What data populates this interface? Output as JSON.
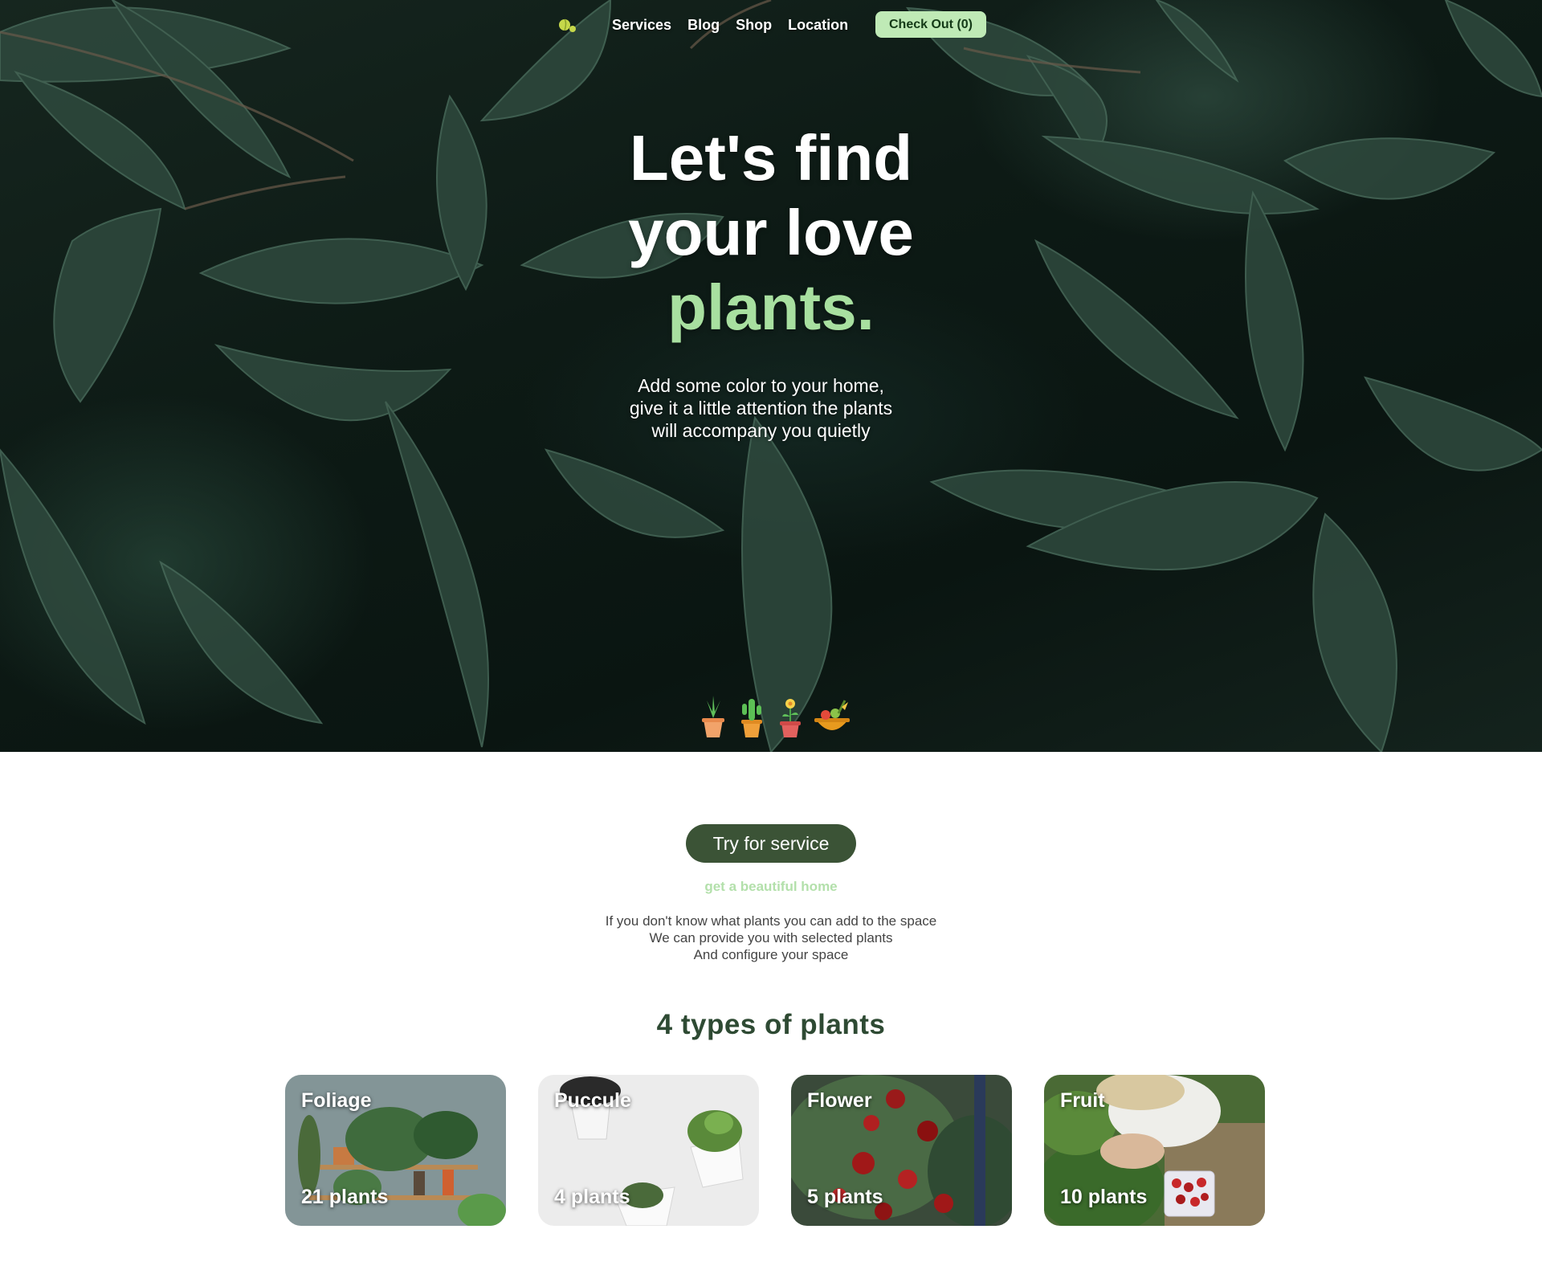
{
  "nav": {
    "links": [
      "Services",
      "Blog",
      "Shop",
      "Location"
    ],
    "checkout_label": "Check Out (0)"
  },
  "hero": {
    "title_line1": "Let's find",
    "title_line2": "your love",
    "title_accent": "plants.",
    "subtitle_lines": [
      "Add some color to your home,",
      "give it a little attention the plants",
      "will accompany you quietly"
    ],
    "pot_icons": [
      "succulent-pot-icon",
      "cactus-pot-icon",
      "flower-pot-icon",
      "fruit-bowl-icon"
    ]
  },
  "service": {
    "button_label": "Try for service",
    "tagline": "get a beautiful home",
    "description_lines": [
      "If you don't know what plants you can add to the space",
      "We can provide you with selected plants",
      "And configure your space"
    ]
  },
  "types": {
    "title": "4 types of plants",
    "cards": [
      {
        "name": "Foliage",
        "count": "21 plants"
      },
      {
        "name": "Puccule",
        "count": "4 plants"
      },
      {
        "name": "Flower",
        "count": "5 plants"
      },
      {
        "name": "Fruit",
        "count": "10 plants"
      }
    ]
  },
  "colors": {
    "accent_green": "#a8e0a0",
    "button_dark_green": "#3b5336",
    "checkout_bg": "#bfeab6",
    "heading_green": "#2e4a33"
  }
}
